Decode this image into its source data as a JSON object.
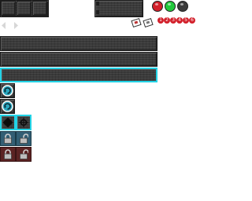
{
  "palette": {
    "accent_cyan": "#22d3e6",
    "metal_dark": "#3a3a3a",
    "lamp_red": "#d21f2a",
    "lamp_green": "#22c93c",
    "lamp_off": "#3b3b3b",
    "lock_bg_blue": "#335f74",
    "lock_bg_red": "#5b2323"
  },
  "top_tiles": [
    "",
    "",
    ""
  ],
  "status_lamps": [
    {
      "name": "red-lamp"
    },
    {
      "name": "green-lamp"
    },
    {
      "name": "off-lamp"
    }
  ],
  "badges": [
    "1",
    "2",
    "3",
    "4",
    "5",
    "6"
  ],
  "icons": {
    "arrow_left": "left-arrow-icon",
    "arrow_right": "right-arrow-icon",
    "card_1": "card-icon",
    "card_2": "card-icon",
    "refresh_1": "refresh-icon",
    "refresh_2": "refresh-icon",
    "diamond": "diamond-icon",
    "crosshair": "crosshair-icon",
    "lock_closed": "lock-closed-icon",
    "lock_open": "lock-open-icon"
  },
  "bars": [
    {
      "name": "bar-1",
      "selected": false
    },
    {
      "name": "bar-2",
      "selected": false
    },
    {
      "name": "bar-3",
      "selected": true
    }
  ]
}
